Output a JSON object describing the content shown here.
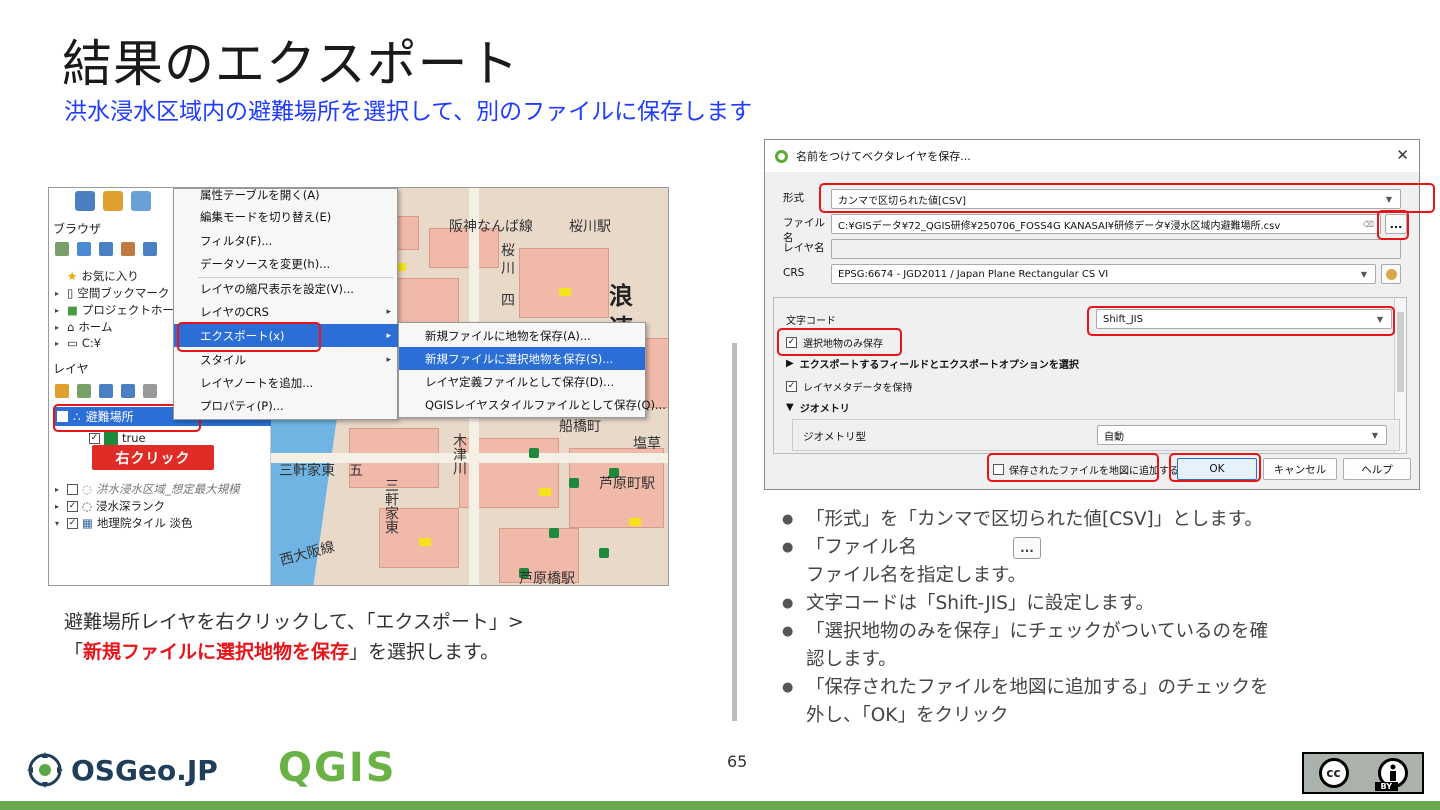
{
  "slide": {
    "title": "結果のエクスポート",
    "subtitle": "洪水浸水区域内の避難場所を選択して、別のファイルに保存します",
    "page_number": "65"
  },
  "left_shot": {
    "browser_title": "ブラウザ",
    "browser_items": [
      "お気に入り",
      "空間ブックマーク",
      "プロジェクトホーム",
      "ホーム",
      "C:¥"
    ],
    "layers_title": "レイヤ",
    "layers": {
      "selected": "避難場所",
      "sub": "true",
      "others": [
        "洪水浸水区域_想定最大規模",
        "浸水深ランク",
        "地理院タイル 淡色"
      ]
    },
    "right_click_label": "右クリック",
    "context_menu": {
      "items": [
        "属性テーブルを開く(A)",
        "編集モードを切り替え(E)",
        "フィルタ(F)...",
        "データソースを変更(h)...",
        "レイヤの縮尺表示を設定(V)...",
        "レイヤのCRS",
        "エクスポート(x)",
        "スタイル",
        "レイヤノートを追加...",
        "プロパティ(P)..."
      ],
      "submenu": [
        "新規ファイルに地物を保存(A)...",
        "新規ファイルに選択地物を保存(S)...",
        "レイヤ定義ファイルとして保存(D)...",
        "QGISレイヤスタイルファイルとして保存(Q)..."
      ]
    },
    "map_labels": [
      "浪",
      "速",
      "三軒家東",
      "五",
      "塩草",
      "西大阪線",
      "木津川",
      "三軒家東",
      "桜",
      "川",
      "四",
      "船橋町",
      "芦原町駅",
      "阪神なんば線",
      "桜川駅",
      "芦原橋駅"
    ]
  },
  "left_caption": {
    "line1": "避難場所レイヤを右クリックして、「エクスポート」>",
    "line2_prefix": "「",
    "line2_emph": "新規ファイルに選択地物を保存",
    "line2_suffix": "」を選択します。"
  },
  "dialog": {
    "title": "名前をつけてベクタレイヤを保存...",
    "format_label": "形式",
    "format_value": "カンマで区切られた値[CSV]",
    "filename_label": "ファイル名",
    "filename_value": "C:¥GISデータ¥72_QGIS研修¥250706_FOSS4G KANASAI¥研修データ¥浸水区域内避難場所.csv",
    "dots": "...",
    "layername_label": "レイヤ名",
    "crs_label": "CRS",
    "crs_value": "EPSG:6674 - JGD2011 / Japan Plane Rectangular CS VI",
    "encoding_label": "文字コード",
    "encoding_value": "Shift_JIS",
    "selected_only": "選択地物のみ保存",
    "fields_section": "エクスポートするフィールドとエクスポートオプションを選択",
    "keep_metadata": "レイヤメタデータを保持",
    "geometry_section": "ジオメトリ",
    "geometry_type_label": "ジオメトリ型",
    "geometry_type_value": "自動",
    "add_to_map": "保存されたファイルを地図に追加する",
    "ok": "OK",
    "cancel": "キャンセル",
    "help": "ヘルプ"
  },
  "bullets": [
    "「形式」を「カンマで区切られた値[CSV]」とします。",
    "「ファイル名",
    "ファイル名を指定します。",
    "文字コードは「Shift-JIS」に設定します。",
    "「選択地物のみを保存」にチェックがついているのを確",
    "認します。",
    "「保存されたファイルを地図に追加する」のチェックを",
    "外し、「OK」をクリック"
  ],
  "inline_button": "...",
  "footer": {
    "osgeo": "OSGeo.JP",
    "qgis": "QGIS",
    "cc": "cc",
    "by": "BY"
  }
}
